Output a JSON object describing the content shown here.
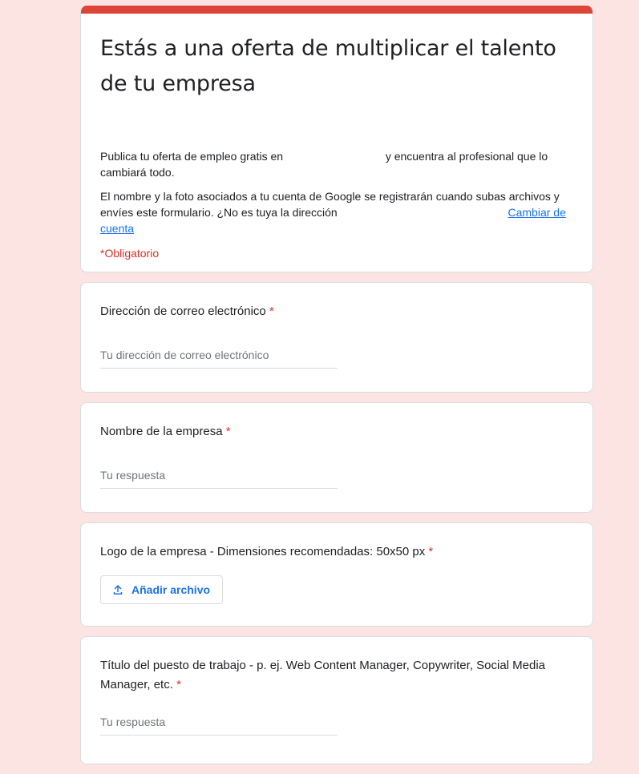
{
  "header": {
    "title": "Estás a una oferta de multiplicar el talento de tu empresa",
    "description_part1": "Publica tu oferta de empleo gratis en",
    "description_part2": "y encuentra al profesional que lo cambiará todo.",
    "account_notice": "El nombre y la foto asociados a tu cuenta de Google se registrarán cuando subas archivos y envíes este formulario. ¿No es tuya la dirección",
    "switch_account_link": "Cambiar de cuenta",
    "required_note": "*Obligatorio"
  },
  "questions": [
    {
      "title": "Dirección de correo electrónico",
      "required_mark": "*",
      "placeholder": "Tu dirección de correo electrónico"
    },
    {
      "title": "Nombre de la empresa",
      "required_mark": "*",
      "placeholder": "Tu respuesta"
    },
    {
      "title": "Logo de la empresa - Dimensiones recomendadas: 50x50 px",
      "required_mark": "*",
      "upload_label": "Añadir archivo",
      "upload_icon": "upload-icon"
    },
    {
      "title": "Título del puesto de trabajo - p. ej. Web Content Manager, Copywriter, Social Media Manager, etc.",
      "required_mark": "*",
      "placeholder": "Tu respuesta"
    }
  ],
  "colors": {
    "background": "#fce4e2",
    "accent_bar": "#db4437",
    "link": "#1a73e8",
    "required": "#d93025"
  }
}
